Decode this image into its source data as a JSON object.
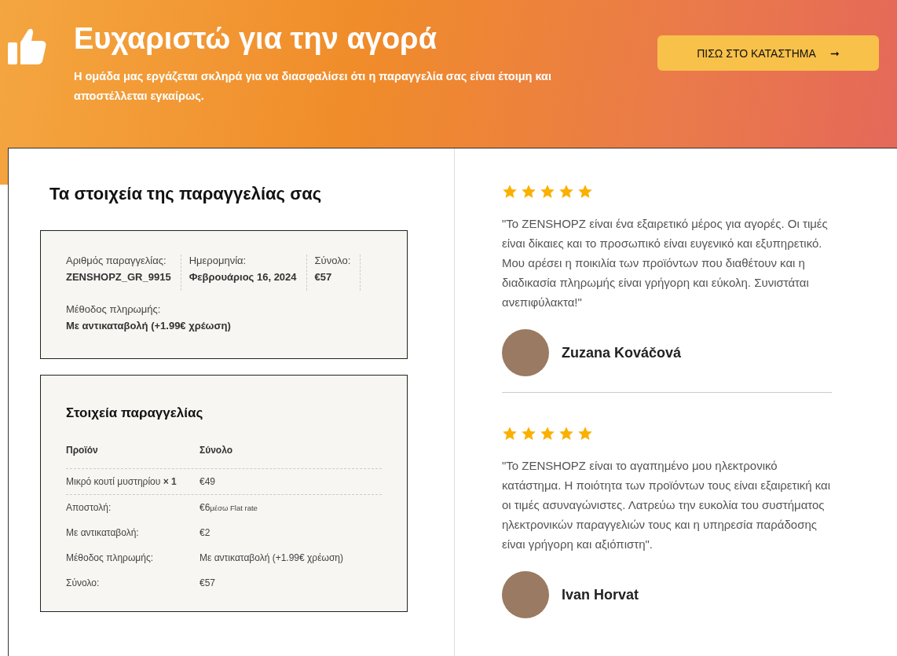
{
  "hero": {
    "title": "Ευχαριστώ για την αγορά",
    "subtitle": "Η ομάδα μας εργάζεται σκληρά για να διασφαλίσει ότι η παραγγελία σας είναι έτοιμη και αποστέλλεται εγκαίρως.",
    "button": {
      "label": "ΠΙΣΩ ΣΤΟ ΚΑΤΑΣΤΗΜΑ",
      "arrow": "➞"
    }
  },
  "order": {
    "heading": "Τα στοιχεία της παραγγελίας σας",
    "summary": [
      {
        "label": "Αριθμός παραγγελίας:",
        "value": "ZENSHOPZ_GR_9915"
      },
      {
        "label": "Ημερομηνία:",
        "value": "Φεβρουάριος 16, 2024"
      },
      {
        "label": "Σύνολο:",
        "value": "€57"
      }
    ],
    "payment": {
      "label": "Μέθοδος πληρωμής:",
      "value": "Με αντικαταβολή (+1.99€ χρέωση)"
    }
  },
  "details": {
    "heading": "Στοιχεία παραγγελίας",
    "columns": [
      "Προϊόν",
      "Σύνολο"
    ],
    "items": [
      {
        "name": "Μικρό κουτί μυστηρίου",
        "qty": "× 1",
        "total": "€49"
      }
    ],
    "totals": [
      {
        "label": "Αποστολή:",
        "value": "€6",
        "note": "μέσω Flat rate"
      },
      {
        "label": "Με αντικαταβολή:",
        "value": "€2"
      },
      {
        "label": "Μέθοδος πληρωμής:",
        "value": "Με αντικαταβολή (+1.99€ χρέωση)"
      },
      {
        "label": "Σύνολο:",
        "value": "€57"
      }
    ]
  },
  "reviews": [
    {
      "stars": 5,
      "text": "\"Το ZENSHOPZ είναι ένα εξαιρετικό μέρος για αγορές. Οι τιμές είναι δίκαιες και το προσωπικό είναι ευγενικό και εξυπηρετικό. Μου αρέσει η ποικιλία των προϊόντων που διαθέτουν και η διαδικασία πληρωμής είναι γρήγορη και εύκολη. Συνιστάται ανεπιφύλακτα!\"",
      "name": "Zuzana Kováčová"
    },
    {
      "stars": 5,
      "text": "\"Το ZENSHOPZ είναι το αγαπημένο μου ηλεκτρονικό κατάστημα. Η ποιότητα των προϊόντων τους είναι εξαιρετική και οι τιμές ασυναγώνιστες. Λατρεύω την ευκολία του συστήματος ηλεκτρονικών παραγγελιών τους και η υπηρεσία παράδοσης είναι γρήγορη και αξιόπιστη\".",
      "name": "Ivan Horvat"
    }
  ]
}
